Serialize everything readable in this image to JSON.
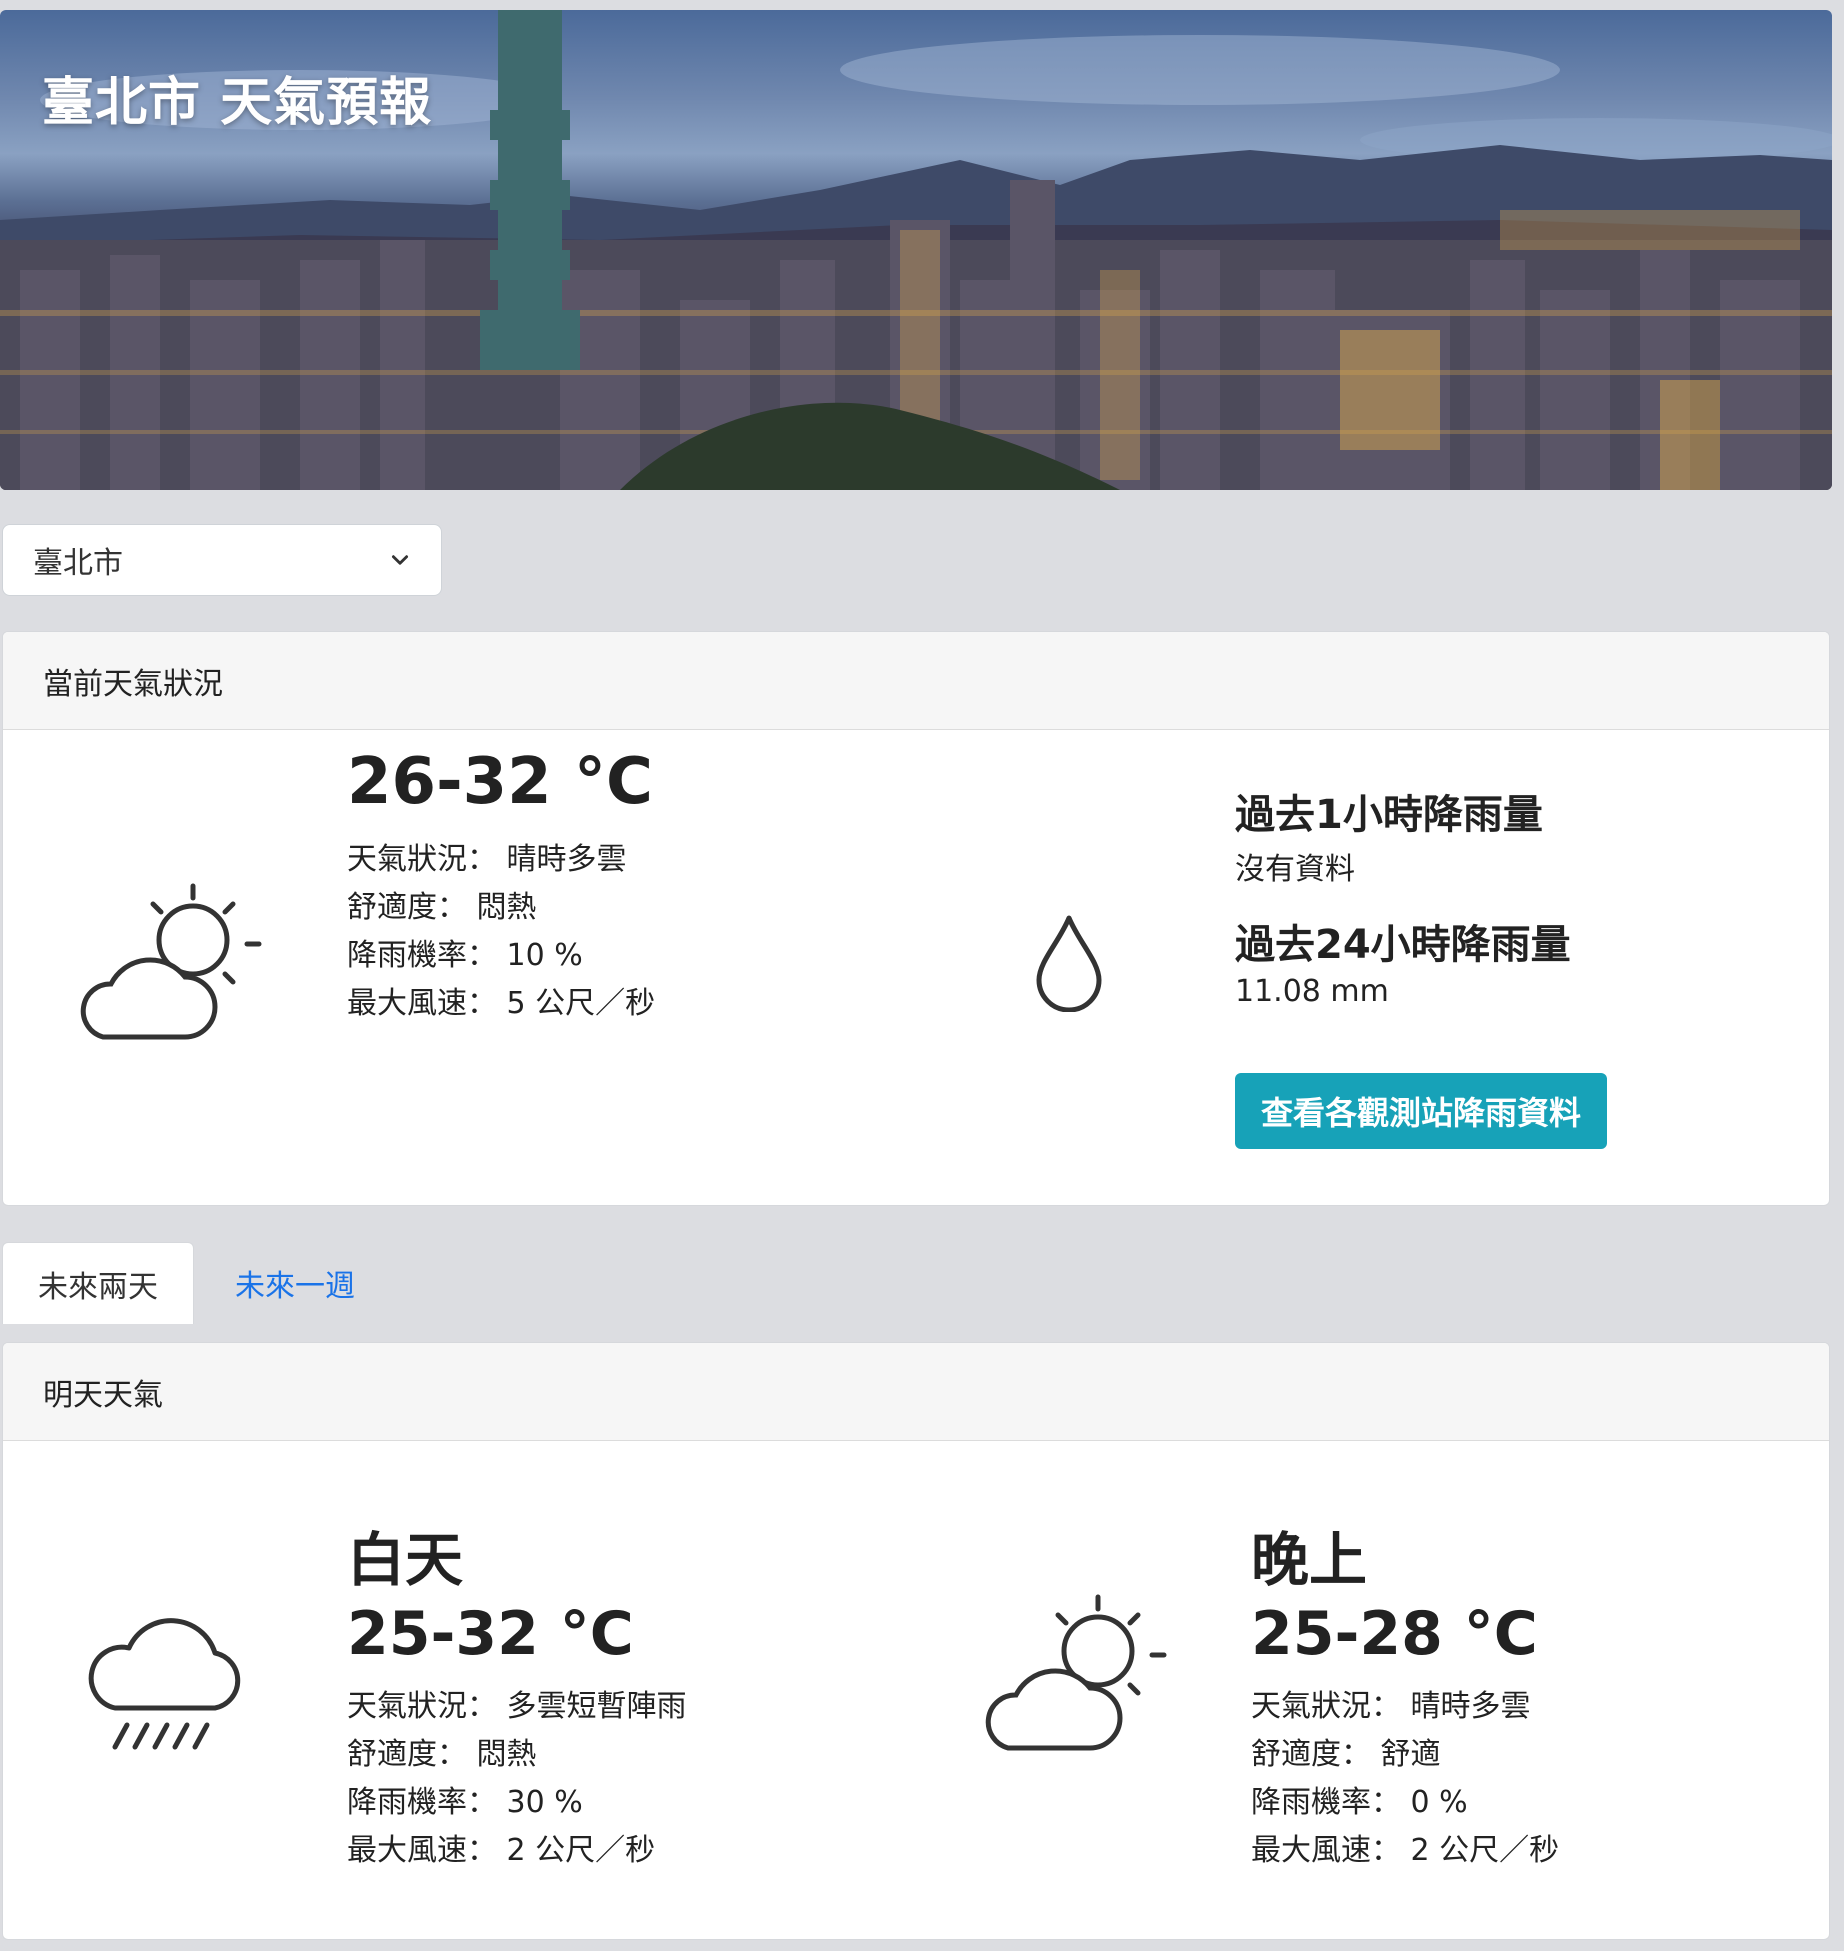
{
  "header": {
    "title": "臺北市 天氣預報"
  },
  "city_select": {
    "value": "臺北市"
  },
  "current": {
    "header": "當前天氣狀況",
    "temp": "26-32 °C",
    "lines": [
      {
        "label": "天氣狀況：",
        "value": "晴時多雲"
      },
      {
        "label": "舒適度：",
        "value": "悶熱"
      },
      {
        "label": "降雨機率：",
        "value": "10 %"
      },
      {
        "label": "最大風速：",
        "value": "5 公尺／秒"
      }
    ],
    "weather_icon": "partly-cloudy-icon",
    "rain_icon": "raindrop-icon",
    "rain_1h_title": "過去1小時降雨量",
    "rain_1h_value": "沒有資料",
    "rain_24h_title": "過去24小時降雨量",
    "rain_24h_value": "11.08 mm",
    "button": "查看各觀測站降雨資料",
    "accent": "#17a2b8"
  },
  "tabs": [
    {
      "label": "未來兩天",
      "active": true
    },
    {
      "label": "未來一週",
      "active": false
    }
  ],
  "tomorrow": {
    "header": "明天天氣",
    "day": {
      "title": "白天",
      "temp": "25-32 °C",
      "icon": "rain-icon",
      "lines": [
        {
          "label": "天氣狀況：",
          "value": "多雲短暫陣雨"
        },
        {
          "label": "舒適度：",
          "value": "悶熱"
        },
        {
          "label": "降雨機率：",
          "value": "30 %"
        },
        {
          "label": "最大風速：",
          "value": "2 公尺／秒"
        }
      ]
    },
    "night": {
      "title": "晚上",
      "temp": "25-28 °C",
      "icon": "partly-cloudy-icon",
      "lines": [
        {
          "label": "天氣狀況：",
          "value": "晴時多雲"
        },
        {
          "label": "舒適度：",
          "value": "舒適"
        },
        {
          "label": "降雨機率：",
          "value": "0 %"
        },
        {
          "label": "最大風速：",
          "value": "2 公尺／秒"
        }
      ]
    }
  }
}
